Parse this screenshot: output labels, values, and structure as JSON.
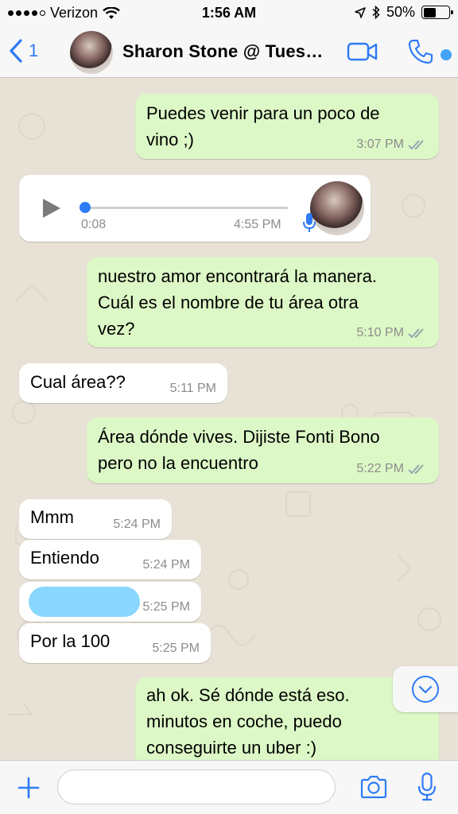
{
  "status_bar": {
    "carrier": "Verizon",
    "time": "1:56 AM",
    "battery": "50%",
    "battery_level": 0.5
  },
  "header": {
    "back_count": "1",
    "title": "Sharon Stone @ Tues…"
  },
  "messages": [
    {
      "direction": "out",
      "text_lines": [
        "Puedes venir para un poco de",
        "vino ;)"
      ],
      "time": "3:07 PM",
      "read": true
    },
    {
      "direction": "in",
      "type": "voice",
      "duration": "0:08",
      "time": "4:55 PM"
    },
    {
      "direction": "out",
      "text_lines": [
        "nuestro amor encontrará la manera.",
        "Cuál es el nombre de tu área otra",
        "vez?"
      ],
      "time": "5:10 PM",
      "read": true
    },
    {
      "direction": "in",
      "text_lines": [
        "Cual área??"
      ],
      "time": "5:11 PM"
    },
    {
      "direction": "out",
      "text_lines": [
        "Área dónde vives. Dijiste Fonti Bono",
        "pero no la encuentro"
      ],
      "time": "5:22 PM",
      "read": true
    },
    {
      "direction": "in",
      "text_lines": [
        "Mmm"
      ],
      "time": "5:24 PM"
    },
    {
      "direction": "in",
      "text_lines": [
        "Entiendo"
      ],
      "time": "5:24 PM"
    },
    {
      "direction": "in",
      "redacted": true,
      "time": "5:25 PM"
    },
    {
      "direction": "in",
      "text_lines": [
        "Por la 100"
      ],
      "time": "5:25 PM"
    },
    {
      "direction": "out",
      "text_lines": [
        "ah ok. Sé dónde está eso.",
        "minutos en coche, puedo",
        "conseguirte un uber :)"
      ]
    }
  ],
  "icons": {
    "back": "chevron-left-icon",
    "video": "video-camera-icon",
    "call": "phone-icon",
    "play": "play-icon",
    "mic": "microphone-icon",
    "add": "plus-icon",
    "camera": "camera-icon",
    "scroll_down": "chevron-down-icon"
  },
  "colors": {
    "accent": "#2e7bf6",
    "outgoing_bubble": "#dcf8c6",
    "incoming_bubble": "#ffffff",
    "background": "#e8e2d6",
    "redaction": "#7fd3ff"
  },
  "input": {
    "placeholder": ""
  }
}
